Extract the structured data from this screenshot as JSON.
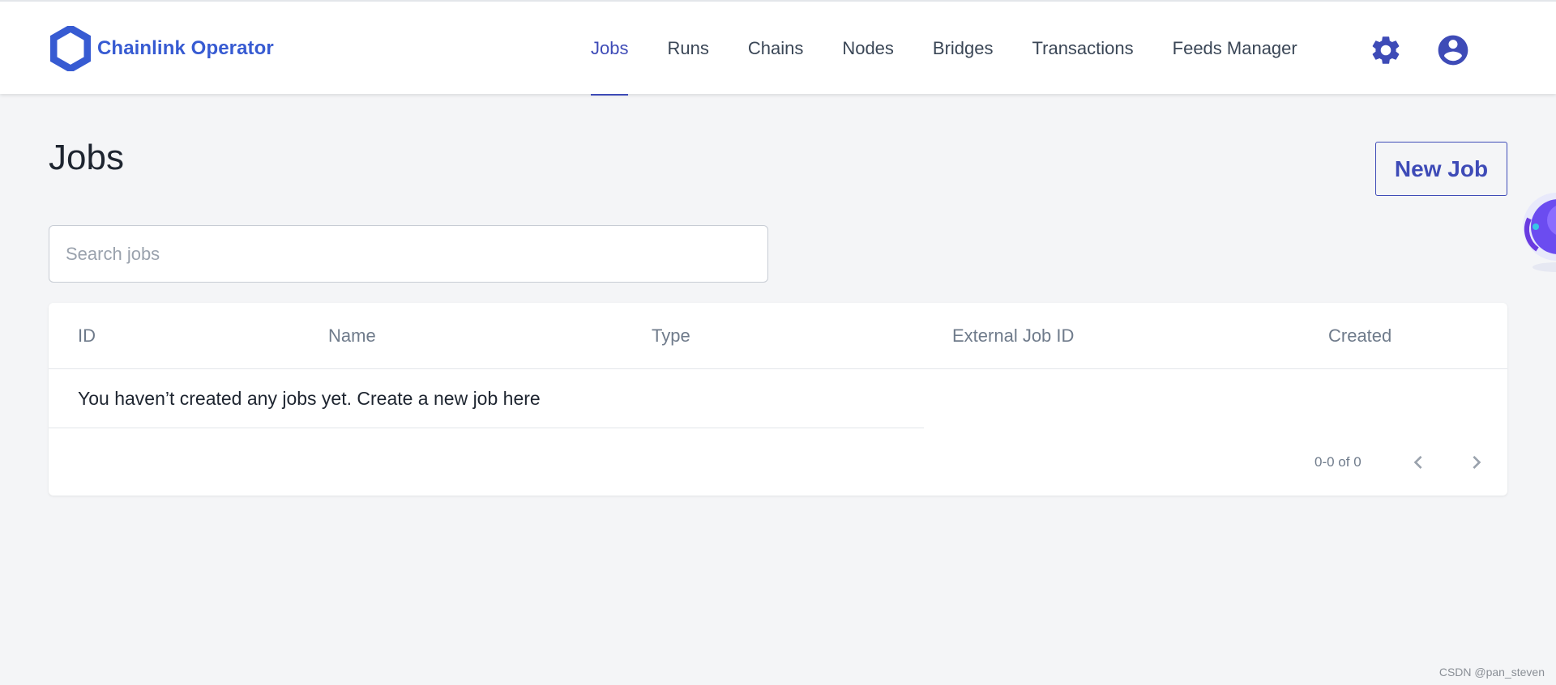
{
  "app": {
    "brand_name": "Chainlink Operator",
    "accent_color": "#375bd2",
    "nav_active_color": "#3e4bb7"
  },
  "nav": {
    "items": [
      {
        "label": "Jobs",
        "active": true
      },
      {
        "label": "Runs",
        "active": false
      },
      {
        "label": "Chains",
        "active": false
      },
      {
        "label": "Nodes",
        "active": false
      },
      {
        "label": "Bridges",
        "active": false
      },
      {
        "label": "Transactions",
        "active": false
      },
      {
        "label": "Feeds Manager",
        "active": false
      }
    ],
    "icons": [
      "gear-icon",
      "account-circle-icon"
    ]
  },
  "main": {
    "title": "Jobs",
    "new_job_label": "New Job",
    "search": {
      "placeholder": "Search jobs",
      "value": ""
    },
    "table": {
      "columns": [
        "ID",
        "Name",
        "Type",
        "External Job ID",
        "Created"
      ],
      "empty_message": "You haven’t created any jobs yet. Create a new job here",
      "pagination": {
        "range_text": "0-0 of 0"
      }
    }
  },
  "footer": {
    "watermark": "CSDN @pan_steven"
  }
}
